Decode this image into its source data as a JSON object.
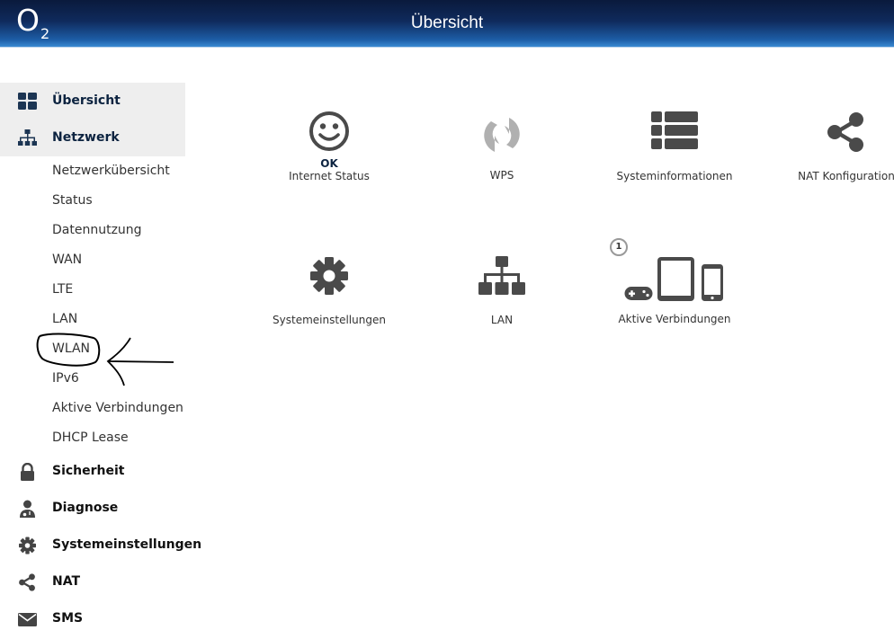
{
  "header": {
    "logo_main": "O",
    "logo_sub": "2",
    "title": "Übersicht",
    "background_color": "#0f2a5c"
  },
  "sidebar": {
    "top_items": [
      {
        "label": "Übersicht",
        "icon": "dashboard-icon"
      },
      {
        "label": "Netzwerk",
        "icon": "network-icon"
      }
    ],
    "sub_items": [
      "Netzwerkübersicht",
      "Status",
      "Datennutzung",
      "WAN",
      "LTE",
      "LAN",
      "WLAN",
      "IPv6",
      "Aktive Verbindungen",
      "DHCP Lease"
    ],
    "bottom_items": [
      {
        "label": "Sicherheit",
        "icon": "lock-icon"
      },
      {
        "label": "Diagnose",
        "icon": "doctor-icon"
      },
      {
        "label": "Systemeinstellungen",
        "icon": "gear-icon"
      },
      {
        "label": "NAT",
        "icon": "share-icon"
      },
      {
        "label": "SMS",
        "icon": "envelope-icon"
      }
    ]
  },
  "tiles": {
    "internet_status": {
      "status": "OK",
      "label": "Internet Status",
      "icon": "smiley-icon"
    },
    "wps": {
      "label": "WPS",
      "icon": "wps-icon"
    },
    "systeminformationen": {
      "label": "Systeminformationen",
      "icon": "list-icon"
    },
    "nat_konfiguration": {
      "label": "NAT Konfiguration",
      "icon": "share-icon"
    },
    "systemeinstellungen": {
      "label": "Systemeinstellungen",
      "icon": "gear-icon"
    },
    "lan": {
      "label": "LAN",
      "icon": "network-icon"
    },
    "aktive_verbindungen": {
      "label": "Aktive Verbindungen",
      "badge": "1",
      "icon": "devices-icon"
    }
  },
  "colors": {
    "accent": "#0c2340",
    "icon": "#4a4a4a",
    "icon_muted": "#b0b0b0",
    "sidebar_highlight": "#eeeeee"
  }
}
